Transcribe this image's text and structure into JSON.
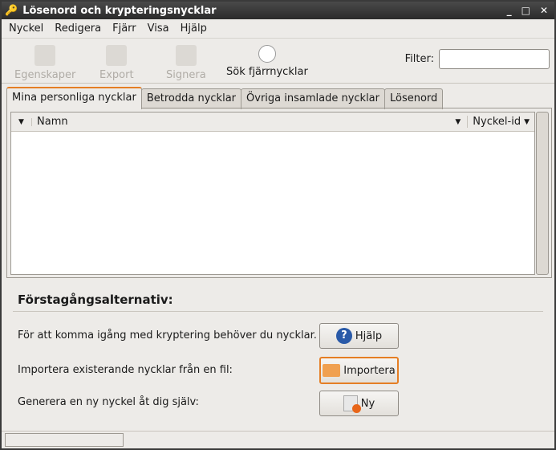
{
  "window": {
    "title": "Lösenord och krypteringsnycklar",
    "controls": [
      "_",
      "□",
      "✕"
    ]
  },
  "menu": [
    "Nyckel",
    "Redigera",
    "Fjärr",
    "Visa",
    "Hjälp"
  ],
  "toolbar": {
    "properties": "Egenskaper",
    "export": "Export",
    "sign": "Signera",
    "search_remote": "Sök fjärrnycklar",
    "filter_label": "Filter:",
    "filter_value": ""
  },
  "tabs": [
    "Mina personliga nycklar",
    "Betrodda nycklar",
    "Övriga insamlade nycklar",
    "Lösenord"
  ],
  "columns": {
    "name": "Namn",
    "key_id": "Nyckel-id"
  },
  "first_time": {
    "heading": "Förstagångsalternativ:",
    "rows": [
      {
        "text": "För att komma igång med kryptering behöver du nycklar.",
        "button": "Hjälp"
      },
      {
        "text": "Importera existerande nycklar från en fil:",
        "button": "Importera"
      },
      {
        "text": "Generera en ny nyckel åt dig själv:",
        "button": "Ny"
      }
    ]
  }
}
